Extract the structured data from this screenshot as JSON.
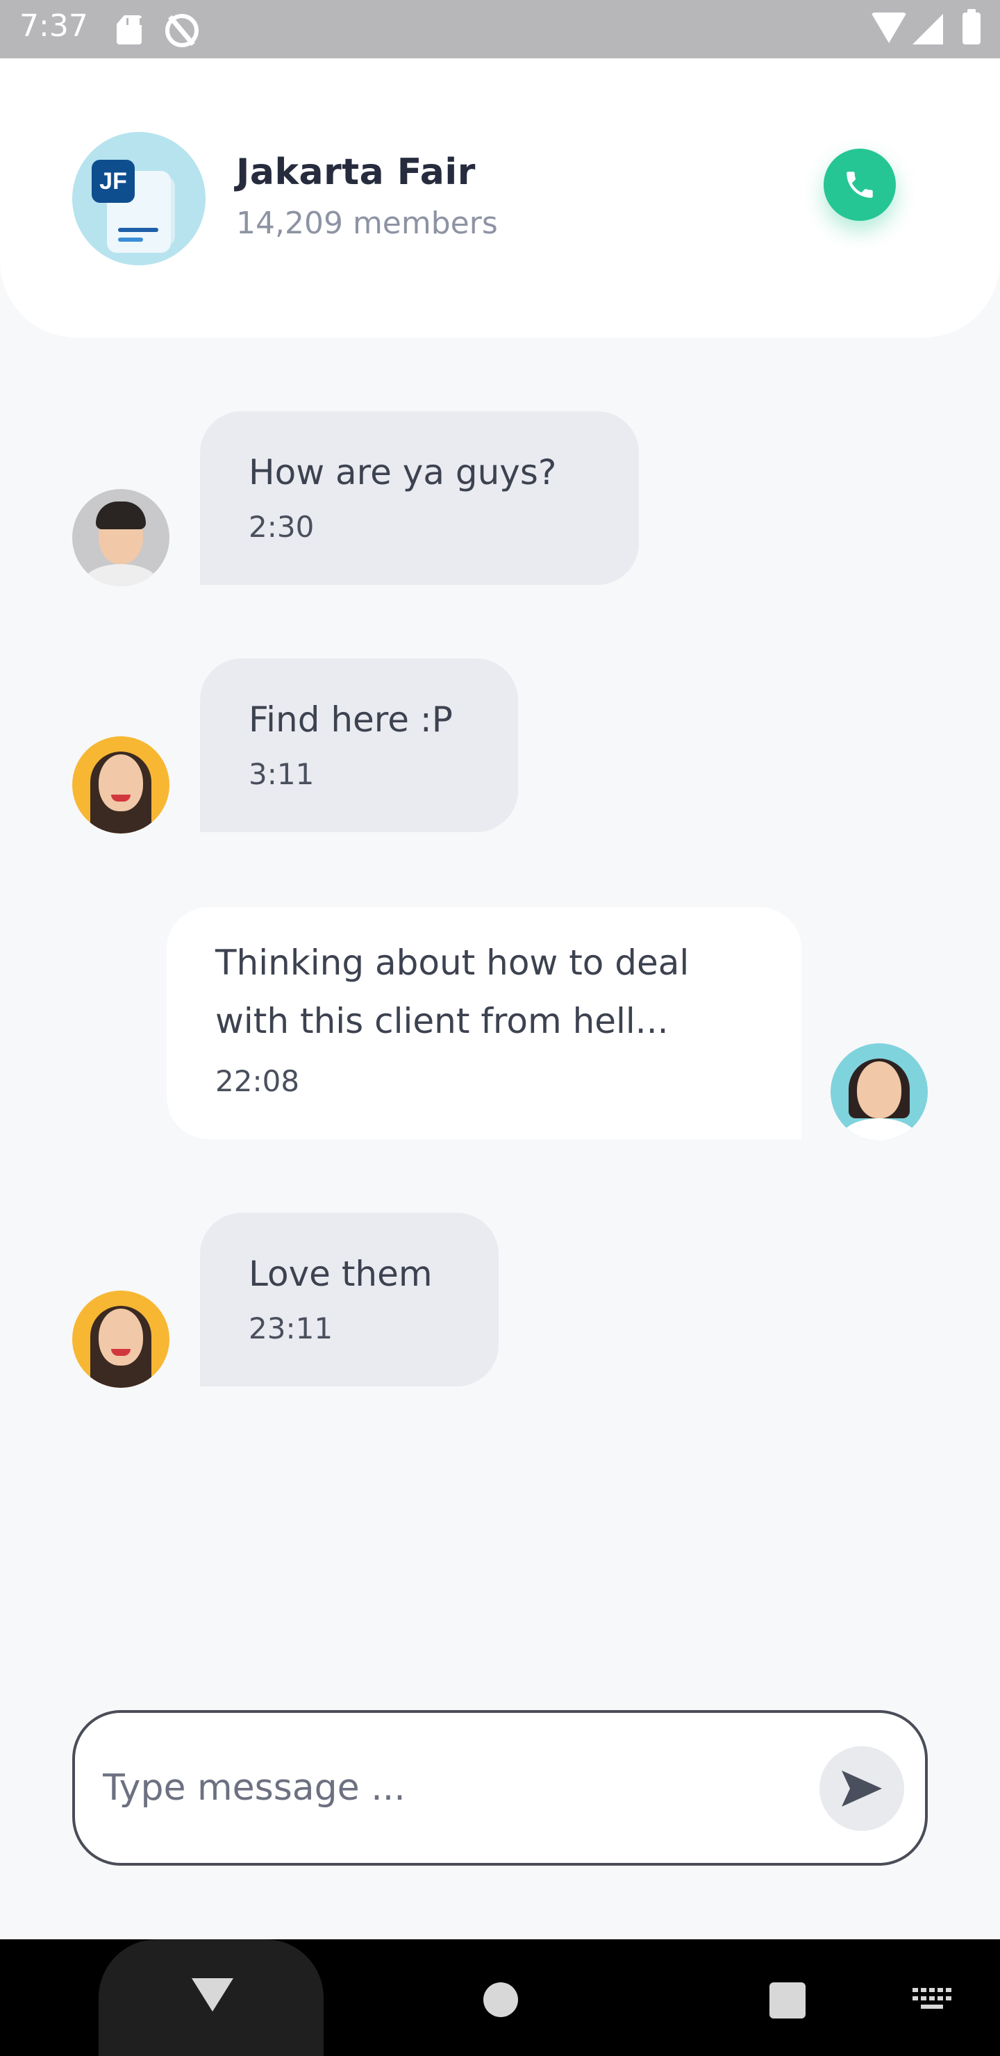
{
  "status_bar": {
    "time": "7:37",
    "icons": [
      "sd-card-icon",
      "sync-icon",
      "wifi-icon",
      "signal-icon",
      "battery-icon"
    ]
  },
  "header": {
    "avatar_badge": "JF",
    "group_name": "Jakarta Fair",
    "members": "14,209 members",
    "call_icon": "phone-icon",
    "colors": {
      "call_button": "#25c693",
      "avatar_bg": "#b6e3ee"
    }
  },
  "messages": [
    {
      "text": "How are ya guys?",
      "time": "2:30",
      "side": "left",
      "avatar": "man-avatar"
    },
    {
      "text": "Find here :P",
      "time": "3:11",
      "side": "left",
      "avatar": "woman-hat-avatar"
    },
    {
      "text_line1": "Thinking about how to deal",
      "text_line2": "with this client from hell...",
      "time": "22:08",
      "side": "right",
      "avatar": "woman-teal-avatar"
    },
    {
      "text": "Love them",
      "time": "23:11",
      "side": "left",
      "avatar": "woman-hat-avatar"
    }
  ],
  "composer": {
    "placeholder": "Type message ...",
    "value": "",
    "send_icon": "send-icon"
  },
  "nav_bar": {
    "icons": [
      "back-icon",
      "home-icon",
      "recents-icon",
      "keyboard-icon"
    ]
  }
}
